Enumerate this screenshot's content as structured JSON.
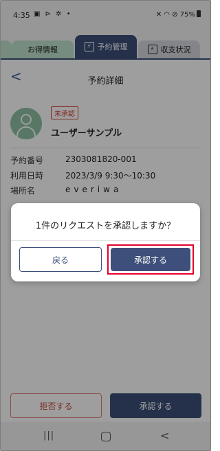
{
  "status_bar": {
    "time": "4:35",
    "left_icons": "▣ ⊳ ✲ •",
    "right_icons": "✕ ◠ ⊘",
    "battery": "75%"
  },
  "tabs": [
    {
      "label": "お得情報",
      "icon": "deals-icon",
      "state": "inactive"
    },
    {
      "label": "予約管理",
      "icon": "reservation-icon",
      "state": "active"
    },
    {
      "label": "収支状況",
      "icon": "income-icon",
      "state": "inactive"
    }
  ],
  "header": {
    "back": "<",
    "title": "予約詳細"
  },
  "profile": {
    "badge": "未承認",
    "name": "ユーザーサンプル"
  },
  "details": [
    {
      "label": "予約番号",
      "value": "2303081820-001"
    },
    {
      "label": "利用日時",
      "value": "2023/3/9 9:30〜10:30"
    },
    {
      "label": "場所名",
      "value": "everiwa"
    }
  ],
  "actions": {
    "reject": "拒否する",
    "approve": "承認する"
  },
  "dialog": {
    "message": "1件のリクエストを承認しますか？",
    "back": "戻る",
    "confirm": "承認する",
    "highlight_color": "#e4002b"
  },
  "nav": {
    "recents": "|||",
    "back": "<"
  },
  "colors": {
    "primary": "#3d4f7a",
    "tab_green": "#bfe3cc",
    "danger": "#c84a3c"
  }
}
